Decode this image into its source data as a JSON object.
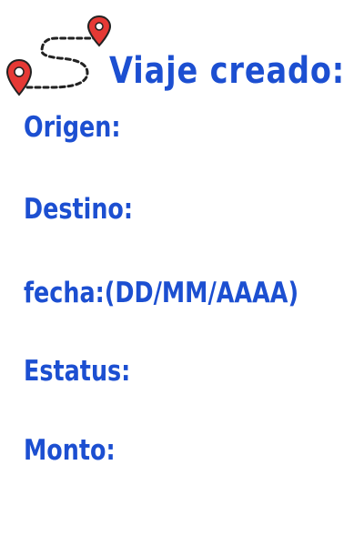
{
  "header": {
    "title": "Viaje creado:",
    "route_icon": "route-pins-icon",
    "pin_color": "#e53935",
    "title_color": "#1c4fd1"
  },
  "fields": [
    {
      "label": "Origen:"
    },
    {
      "label": "Destino:"
    },
    {
      "label": "fecha:(DD/MM/AAAA)"
    },
    {
      "label": "Estatus:"
    },
    {
      "label": "Monto:"
    }
  ]
}
